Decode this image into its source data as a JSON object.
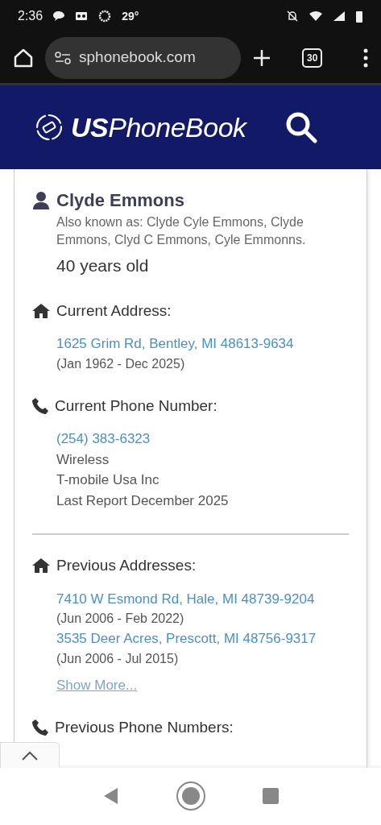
{
  "status_bar": {
    "time": "2:36",
    "temperature": "29°"
  },
  "browser": {
    "url": "sphonebook.com",
    "tab_count": "30"
  },
  "site": {
    "logo_bold": "US",
    "logo_rest": "PhoneBook"
  },
  "person": {
    "name": "Clyde Emmons",
    "aka": "Also known as: Clyde Cyle Emmons, Clyde Emmons, Clyd C Emmons, Cyle Emmonns.",
    "age": "40 years old"
  },
  "sections": [
    {
      "kind": "address",
      "heading": "Current Address:",
      "entries": [
        {
          "link": "1625 Grim Rd, Bentley, MI 48613-9634",
          "details": [
            "(Jan 1962 - Dec 2025)"
          ]
        }
      ]
    },
    {
      "kind": "phone",
      "heading": "Current Phone Number:",
      "entries": [
        {
          "link": "(254) 383-6323",
          "details": [
            "Wireless",
            "T-mobile Usa Inc",
            "Last Report December 2025"
          ]
        }
      ],
      "divider_after": true
    },
    {
      "kind": "address",
      "heading": "Previous Addresses:",
      "entries": [
        {
          "link": "7410 W Esmond Rd, Hale, MI 48739-9204",
          "details": [
            "(Jun 2006 - Feb 2022)"
          ]
        },
        {
          "link": "3535 Deer Acres, Prescott, MI 48756-9317",
          "details": [
            "(Jun 2006 - Jul 2015)"
          ]
        }
      ],
      "show_more": "Show More..."
    },
    {
      "kind": "phone",
      "heading": "Previous Phone Numbers:"
    }
  ]
}
